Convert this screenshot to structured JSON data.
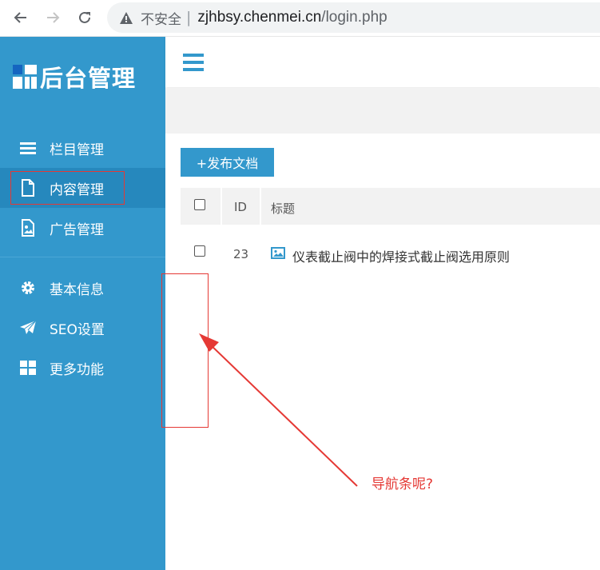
{
  "browser": {
    "security_label": "不安全",
    "separator": "|",
    "url_host": "zjhbsy.chenmei.cn",
    "url_path": "/login.php"
  },
  "sidebar": {
    "logo_text": "后台管理",
    "items": [
      {
        "label": "栏目管理",
        "icon": "list-icon",
        "active": false
      },
      {
        "label": "内容管理",
        "icon": "file-icon",
        "active": true
      },
      {
        "label": "广告管理",
        "icon": "image-file-icon",
        "active": false
      },
      {
        "label": "基本信息",
        "icon": "gear-icon",
        "active": false
      },
      {
        "label": "SEO设置",
        "icon": "paper-plane-icon",
        "active": false
      },
      {
        "label": "更多功能",
        "icon": "grid-icon",
        "active": false
      }
    ]
  },
  "toolbar": {
    "publish_label": "+发布文档"
  },
  "table": {
    "columns": [
      "ID",
      "标题"
    ],
    "rows": [
      {
        "id": "23",
        "title": "仪表截止阀中的焊接式截止阀选用原则"
      }
    ]
  },
  "annotation": {
    "text": "导航条呢?"
  },
  "colors": {
    "sidebar": "#3398cc",
    "sidebar_active": "#2688bd",
    "annotation": "#e53935"
  }
}
